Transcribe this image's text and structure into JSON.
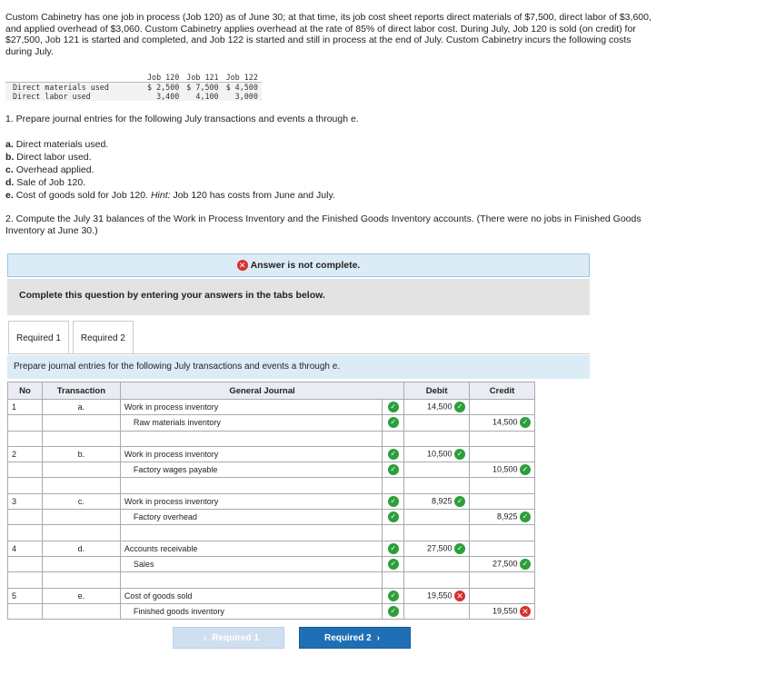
{
  "intro": "Custom Cabinetry has one job in process (Job 120) as of June 30; at that time, its job cost sheet reports direct materials of $7,500, direct labor of $3,600, and applied overhead of $3,060. Custom Cabinetry applies overhead at the rate of 85% of direct labor cost. During July, Job 120 is sold (on credit) for $27,500, Job 121 is started and completed, and Job 122 is started and still in process at the end of July. Custom Cabinetry incurs the following costs during July.",
  "costs": {
    "headers": [
      "Job 120",
      "Job 121",
      "Job 122"
    ],
    "rows": [
      {
        "label": "Direct materials used",
        "values": [
          "$ 2,500",
          "$ 7,500",
          "$ 4,500"
        ]
      },
      {
        "label": "Direct labor used",
        "values": [
          "3,400",
          "4,100",
          "3,000"
        ]
      }
    ]
  },
  "q1": "1. Prepare journal entries for the following July transactions and events a through e.",
  "items": [
    {
      "letter": "a.",
      "text": "Direct materials used."
    },
    {
      "letter": "b.",
      "text": "Direct labor used."
    },
    {
      "letter": "c.",
      "text": "Overhead applied."
    },
    {
      "letter": "d.",
      "text": "Sale of Job 120."
    },
    {
      "letter": "e.",
      "text": "Cost of goods sold for Job 120.",
      "hint": "Hint:",
      "hint_text": "Job 120 has costs from June and July."
    }
  ],
  "q2": "2. Compute the July 31 balances of the Work in Process Inventory and the Finished Goods Inventory accounts. (There were no jobs in Finished Goods Inventory at June 30.)",
  "banner": "Answer is not complete.",
  "complete_msg": "Complete this question by entering your answers in the tabs below.",
  "tabs": [
    "Required 1",
    "Required 2"
  ],
  "prep": "Prepare journal entries for the following July transactions and events a through e.",
  "journal": {
    "headers": {
      "no": "No",
      "transaction": "Transaction",
      "general": "General Journal",
      "debit": "Debit",
      "credit": "Credit"
    },
    "entries": [
      {
        "no": "1",
        "tr": "a.",
        "debit_acct": "Work in process inventory",
        "credit_acct": "Raw materials inventory",
        "debit": "14,500",
        "credit": "14,500",
        "debit_ok": true,
        "credit_ok": true
      },
      {
        "no": "2",
        "tr": "b.",
        "debit_acct": "Work in process inventory",
        "credit_acct": "Factory wages payable",
        "debit": "10,500",
        "credit": "10,500",
        "debit_ok": true,
        "credit_ok": true
      },
      {
        "no": "3",
        "tr": "c.",
        "debit_acct": "Work in process inventory",
        "credit_acct": "Factory overhead",
        "debit": "8,925",
        "credit": "8,925",
        "debit_ok": true,
        "credit_ok": true
      },
      {
        "no": "4",
        "tr": "d.",
        "debit_acct": "Accounts receivable",
        "credit_acct": "Sales",
        "debit": "27,500",
        "credit": "27,500",
        "debit_ok": true,
        "credit_ok": true
      },
      {
        "no": "5",
        "tr": "e.",
        "debit_acct": "Cost of goods sold",
        "credit_acct": "Finished goods inventory",
        "debit": "19,550",
        "credit": "19,550",
        "debit_ok": false,
        "credit_ok": false
      }
    ]
  },
  "nav": {
    "prev": "Required 1",
    "next": "Required 2"
  }
}
